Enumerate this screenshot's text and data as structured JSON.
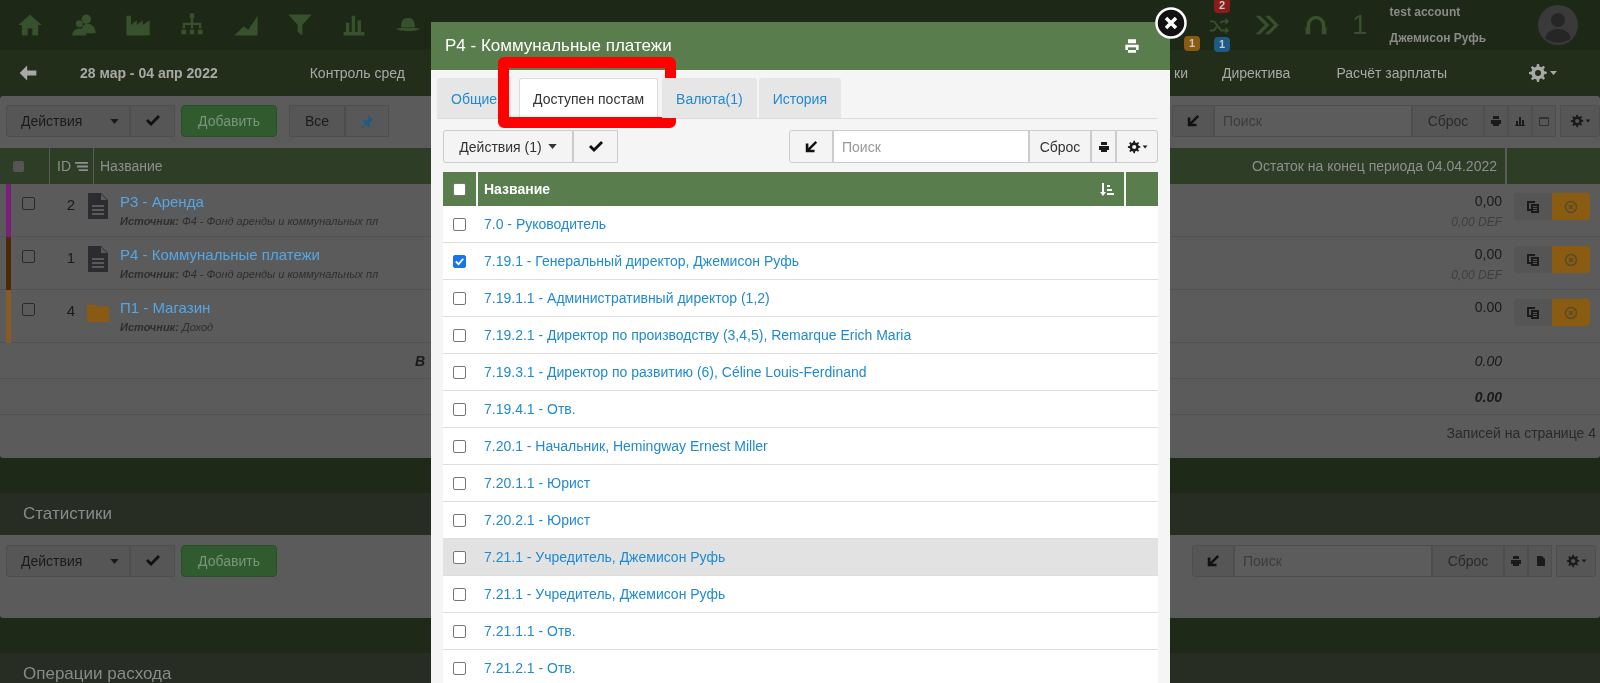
{
  "topbar": {
    "badges": [
      {
        "text": "1",
        "color": "#8a5a10"
      },
      {
        "text": "2",
        "color": "#8a1c1c"
      },
      {
        "text": "1",
        "color": "#1d5a85"
      }
    ],
    "counter": "1",
    "user": {
      "account": "test account",
      "name": "Джемисон Руфь"
    }
  },
  "subbar": {
    "period": "28 мар - 04 апр 2022",
    "menu_left": [
      "Контроль сред"
    ],
    "menu_right": [
      "ки",
      "Директива",
      "Расчёт зарплаты"
    ]
  },
  "main": {
    "toolbar": {
      "actions": "Действия",
      "add": "Добавить",
      "all": "Все",
      "search_placeholder": "Поиск",
      "reset": "Сброс"
    },
    "all_checked": false,
    "columns": [
      "ID",
      "Название",
      "Остаток на конец периода 04.04.2022"
    ],
    "rows": [
      {
        "checked": false,
        "id": "2",
        "kind": "document",
        "name": "Р3 - Аренда",
        "source": "**Источник:** Ф4 - Фонд аренды и коммунальных пл",
        "balance": "0,00",
        "balance_sub": "0,00 DEF",
        "color": "#7a1f7a"
      },
      {
        "checked": false,
        "id": "1",
        "kind": "document",
        "name": "Р4 - Коммунальные платежи",
        "source": "**Источник:** Ф4 - Фонд аренды и коммунальных пл",
        "balance": "0,00",
        "balance_sub": "0,00 DEF",
        "color": "#4a2a08"
      },
      {
        "checked": false,
        "id": "4",
        "kind": "folder",
        "name": "П1 - Магазин",
        "source": "**Источник:** Доход",
        "balance": "0.00",
        "color": "#8a5a25"
      }
    ],
    "totals": [
      {
        "label": "В",
        "value": "0.00"
      },
      {
        "value": "0.00"
      }
    ],
    "footer": "Записей на странице 4"
  },
  "sections": [
    {
      "title": "Статистики",
      "toolbar": {
        "actions": "Действия",
        "add": "Добавить",
        "search_placeholder": "Поиск",
        "reset": "Сброс"
      }
    },
    {
      "title": "Операции расхода"
    }
  ],
  "modal": {
    "title": "Р4 - Коммунальные платежи",
    "tabs": [
      {
        "label": "Общие",
        "selected": false,
        "highlighted": false
      },
      {
        "label": "Доступен постам",
        "selected": true,
        "highlighted": true
      },
      {
        "label": "Валюта(1)",
        "selected": false,
        "highlighted": false
      },
      {
        "label": "История",
        "selected": false,
        "highlighted": false
      }
    ],
    "toolbar": {
      "actions": "Действия (1)",
      "search_placeholder": "Поиск",
      "reset": "Сброс"
    },
    "all_checked": false,
    "column": "Название",
    "rows": [
      {
        "label": "7.0 - Руководитель",
        "checked": false,
        "hovered": false
      },
      {
        "label": "7.19.1 - Генеральный директор, Джемисон Руфь",
        "checked": true,
        "hovered": false
      },
      {
        "label": "7.19.1.1 - Административный директор (1,2)",
        "checked": false,
        "hovered": false
      },
      {
        "label": "7.19.2.1 - Директор по производству (3,4,5), Remarque Erich Maria",
        "checked": false,
        "hovered": false
      },
      {
        "label": "7.19.3.1 - Директор по развитию (6), Céline Louis-Ferdinand",
        "checked": false,
        "hovered": false
      },
      {
        "label": "7.19.4.1 - Отв.",
        "checked": false,
        "hovered": false
      },
      {
        "label": "7.20.1 - Начальник, Hemingway Ernest Miller",
        "checked": false,
        "hovered": false
      },
      {
        "label": "7.20.1.1 - Юрист",
        "checked": false,
        "hovered": false
      },
      {
        "label": "7.20.2.1 - Юрист",
        "checked": false,
        "hovered": false
      },
      {
        "label": "7.21.1 - Учредитель, Джемисон Руфь",
        "checked": false,
        "hovered": true
      },
      {
        "label": "7.21.1 - Учредитель, Джемисон Руфь",
        "checked": false,
        "hovered": false
      },
      {
        "label": "7.21.1.1 - Отв.",
        "checked": false,
        "hovered": false
      },
      {
        "label": "7.21.2.1 - Отв.",
        "checked": false,
        "hovered": false
      }
    ]
  }
}
